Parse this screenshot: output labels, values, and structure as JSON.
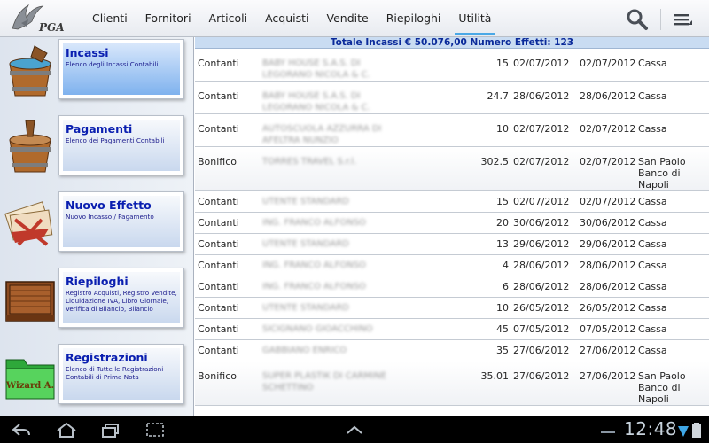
{
  "app": {
    "logo_text": "PGA",
    "tabs": [
      {
        "label": "Clienti",
        "active": false
      },
      {
        "label": "Fornitori",
        "active": false
      },
      {
        "label": "Articoli",
        "active": false
      },
      {
        "label": "Acquisti",
        "active": false
      },
      {
        "label": "Vendite",
        "active": false
      },
      {
        "label": "Riepiloghi",
        "active": false
      },
      {
        "label": "Utilità",
        "active": true
      }
    ],
    "actions": {
      "search_icon": "search-icon",
      "menu_icon": "overflow-menu-icon"
    },
    "accent_color": "#4aa8e6"
  },
  "sidebar": {
    "items": [
      {
        "title": "Incassi",
        "desc": "Elenco degli Incassi Contabili",
        "icon": "bucket-icon",
        "selected": true
      },
      {
        "title": "Pagamenti",
        "desc": "Elenco dei Pagamenti Contabili",
        "icon": "bucket-icon",
        "selected": false
      },
      {
        "title": "Nuovo Effetto",
        "desc": "Nuovo Incasso / Pagamento",
        "icon": "mail-bundle-icon",
        "selected": false
      },
      {
        "title": "Riepiloghi",
        "desc": "Registro Acquisti, Registro Vendite, Liquidazione IVA, Libro Giornale, Verifica di Bilancio, Bilancio",
        "icon": "wooden-crate-icon",
        "selected": false
      },
      {
        "title": "Registrazioni",
        "desc": "Elenco di Tutte le Registrazioni Contabili di Prima Nota",
        "icon": "wizard-folder-icon",
        "badge": "Wizard A.",
        "selected": false
      }
    ]
  },
  "main": {
    "summary": "Totale Incassi € 50.076,00 Numero Effetti: 123",
    "rows": [
      {
        "type": "Contanti",
        "name": "BABY HOUSE S.A.S. DI LEGORANO NICOLA & C.",
        "amount": "15",
        "date1": "02/07/2012",
        "date2": "02/07/2012",
        "account": "Cassa"
      },
      {
        "type": "Contanti",
        "name": "BABY HOUSE S.A.S. DI LEGORANO NICOLA & C.",
        "amount": "24.7",
        "date1": "28/06/2012",
        "date2": "28/06/2012",
        "account": "Cassa"
      },
      {
        "type": "Contanti",
        "name": "AUTOSCUOLA AZZURRA DI AFELTRA NUNZIO",
        "amount": "10",
        "date1": "02/07/2012",
        "date2": "02/07/2012",
        "account": "Cassa"
      },
      {
        "type": "Bonifico",
        "name": "TORRES TRAVEL S.r.l.",
        "amount": "302.5",
        "date1": "02/07/2012",
        "date2": "02/07/2012",
        "account": "San Paolo Banco di Napoli"
      },
      {
        "type": "Contanti",
        "name": "UTENTE STANDARD",
        "amount": "15",
        "date1": "02/07/2012",
        "date2": "02/07/2012",
        "account": "Cassa"
      },
      {
        "type": "Contanti",
        "name": "ING. FRANCO ALFONSO",
        "amount": "20",
        "date1": "30/06/2012",
        "date2": "30/06/2012",
        "account": "Cassa"
      },
      {
        "type": "Contanti",
        "name": "UTENTE STANDARD",
        "amount": "13",
        "date1": "29/06/2012",
        "date2": "29/06/2012",
        "account": "Cassa"
      },
      {
        "type": "Contanti",
        "name": "ING. FRANCO ALFONSO",
        "amount": "4",
        "date1": "28/06/2012",
        "date2": "28/06/2012",
        "account": "Cassa"
      },
      {
        "type": "Contanti",
        "name": "ING. FRANCO ALFONSO",
        "amount": "6",
        "date1": "28/06/2012",
        "date2": "28/06/2012",
        "account": "Cassa"
      },
      {
        "type": "Contanti",
        "name": "UTENTE STANDARD",
        "amount": "10",
        "date1": "26/05/2012",
        "date2": "26/05/2012",
        "account": "Cassa"
      },
      {
        "type": "Contanti",
        "name": "SICIGNANO GIOACCHINO",
        "amount": "45",
        "date1": "07/05/2012",
        "date2": "07/05/2012",
        "account": "Cassa"
      },
      {
        "type": "Contanti",
        "name": "GABBIANO ENRICO",
        "amount": "35",
        "date1": "27/06/2012",
        "date2": "27/06/2012",
        "account": "Cassa"
      },
      {
        "type": "Bonifico",
        "name": "SUPER PLASTIK DI CARMINE SCHETTINO",
        "amount": "35.01",
        "date1": "27/06/2012",
        "date2": "27/06/2012",
        "account": "San Paolo Banco di Napoli"
      }
    ]
  },
  "system_bar": {
    "clock": "12:48",
    "nav_icons": [
      "back-icon",
      "home-icon",
      "recent-apps-icon",
      "screenshot-icon",
      "up-chevron-icon"
    ],
    "status_icons": [
      "usb-icon",
      "wifi-icon",
      "battery-icon"
    ]
  }
}
